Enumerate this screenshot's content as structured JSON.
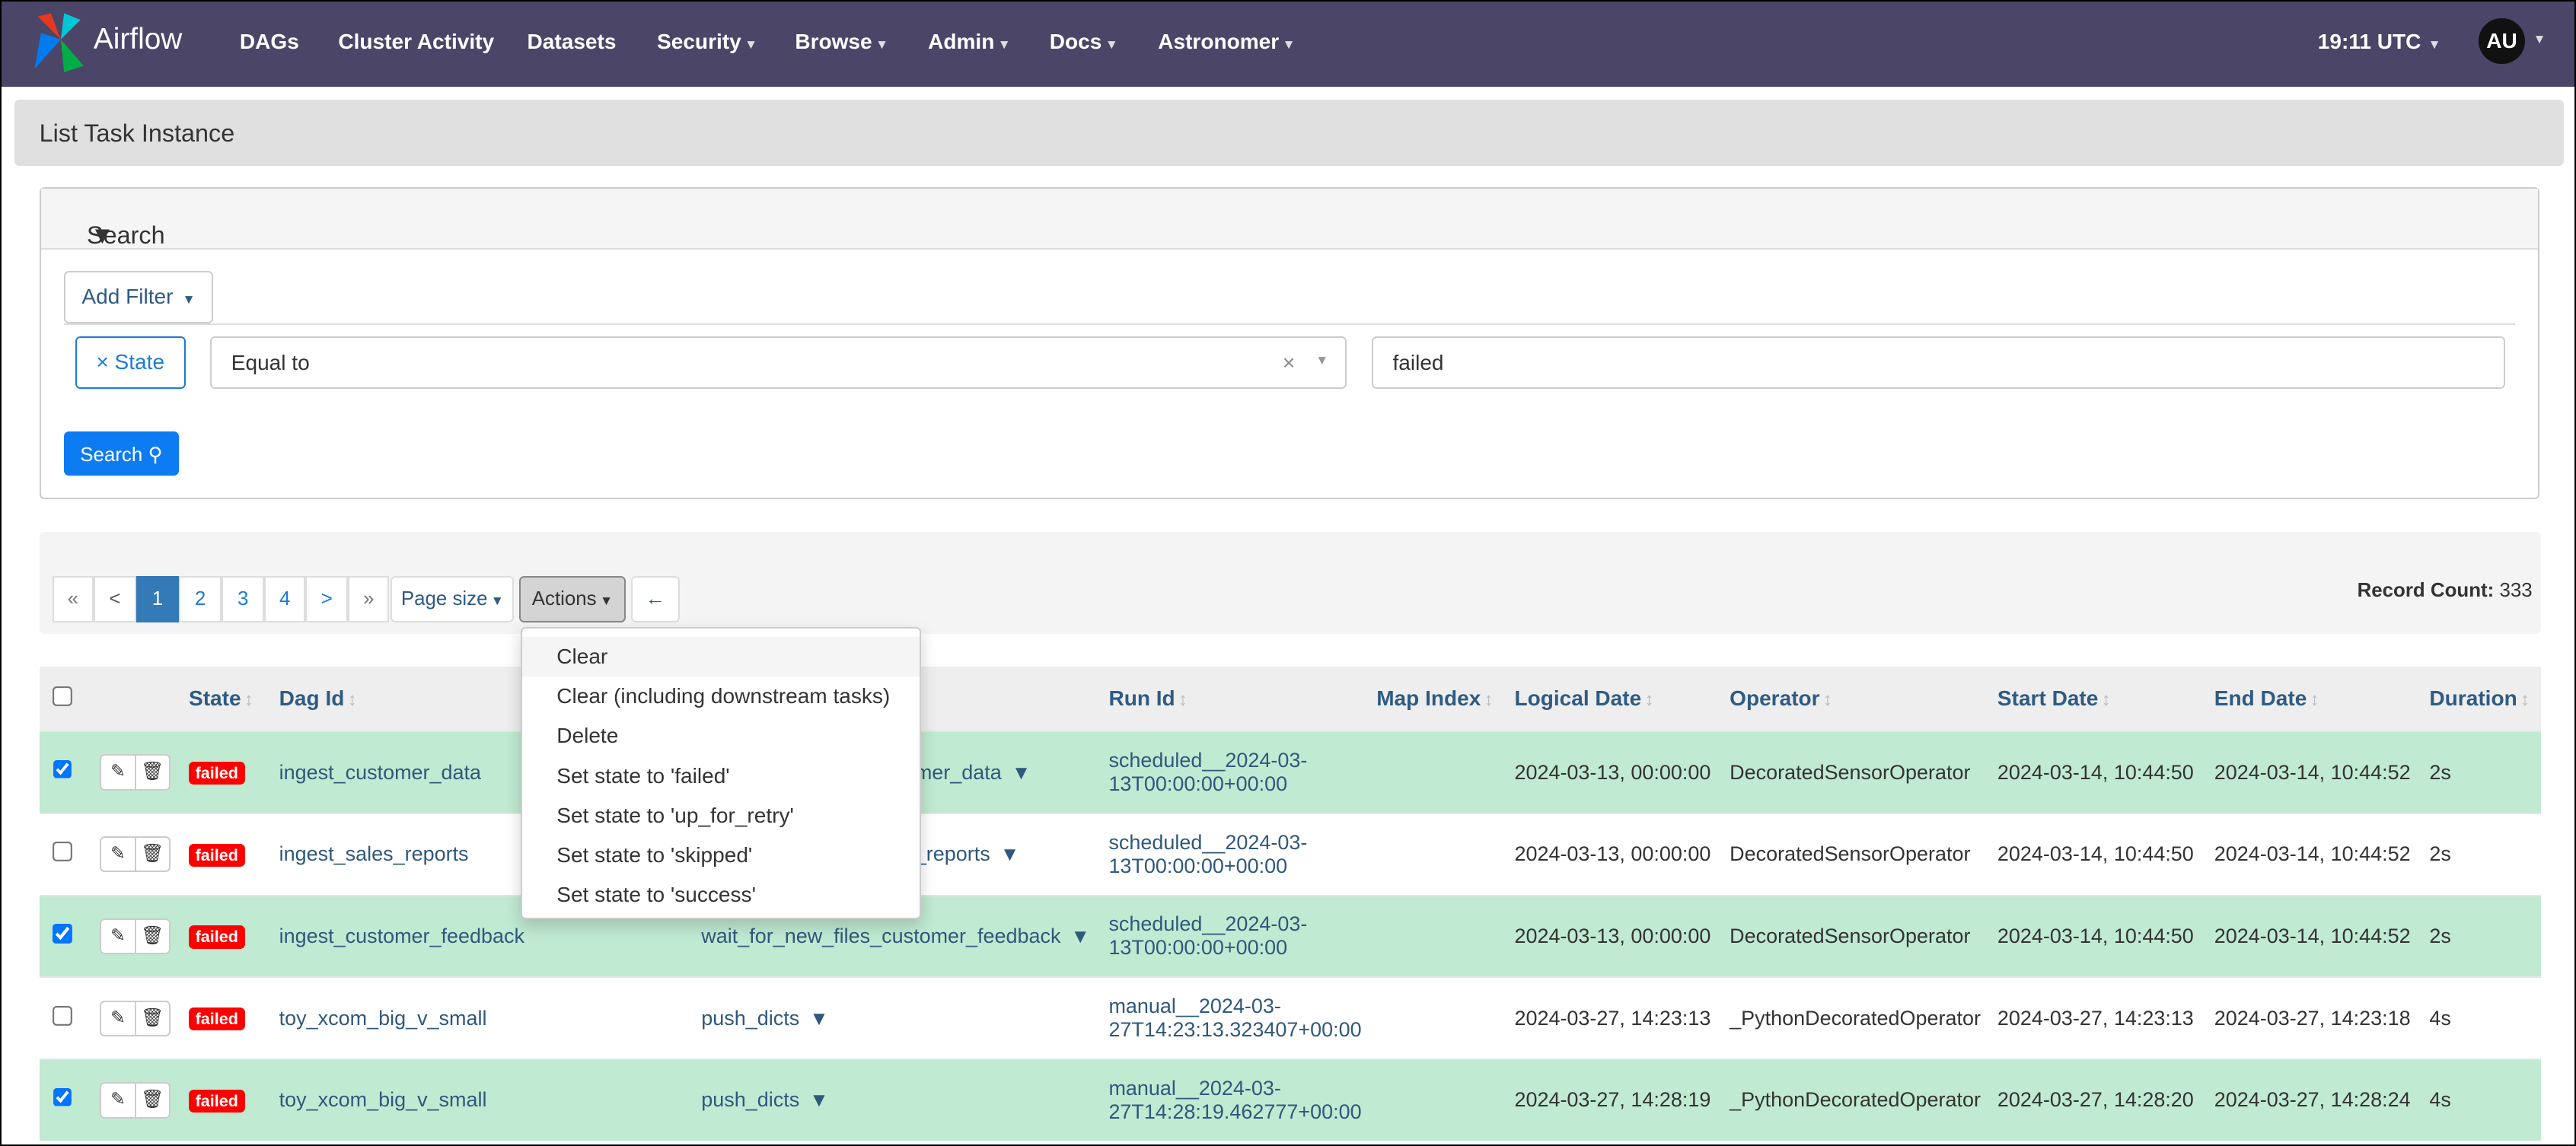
{
  "nav": {
    "brand": "Airflow",
    "items": [
      "DAGs",
      "Cluster Activity",
      "Datasets",
      "Security",
      "Browse",
      "Admin",
      "Docs",
      "Astronomer"
    ],
    "time": "19:11 UTC",
    "user_initials": "AU"
  },
  "page_title": "List Task Instance",
  "search": {
    "title": "Search",
    "add_filter": "Add Filter",
    "filter_field": "× State",
    "operator": "Equal to",
    "clear": "×",
    "value": "failed",
    "search_button": "Search"
  },
  "pagination": {
    "first": "«",
    "prev": "<",
    "pages": [
      "1",
      "2",
      "3",
      "4"
    ],
    "active_page": "1",
    "next": ">",
    "last": "»",
    "page_size": "Page size",
    "actions": "Actions",
    "back": "←"
  },
  "record_count": {
    "label": "Record Count:",
    "value": "333"
  },
  "actions_menu": [
    "Clear",
    "Clear (including downstream tasks)",
    "Delete",
    "Set state to 'failed'",
    "Set state to 'up_for_retry'",
    "Set state to 'skipped'",
    "Set state to 'success'"
  ],
  "table": {
    "headers": {
      "state": "State",
      "dag_id": "Dag Id",
      "run_id": "Run Id",
      "map_index": "Map Index",
      "logical_date": "Logical Date",
      "operator": "Operator",
      "start_date": "Start Date",
      "end_date": "End Date",
      "duration": "Duration"
    },
    "rows": [
      {
        "checked": true,
        "state": "failed",
        "dag_id": "ingest_customer_data",
        "task_id": "mer_data",
        "run_id_1": "scheduled__2024-03-",
        "run_id_2": "13T00:00:00+00:00",
        "logical_date": "2024-03-13, 00:00:00",
        "operator": "DecoratedSensorOperator",
        "start_date": "2024-03-14, 10:44:50",
        "end_date": "2024-03-14, 10:44:52",
        "duration": "2s"
      },
      {
        "checked": false,
        "state": "failed",
        "dag_id": "ingest_sales_reports",
        "task_id": "_reports",
        "run_id_1": "scheduled__2024-03-",
        "run_id_2": "13T00:00:00+00:00",
        "logical_date": "2024-03-13, 00:00:00",
        "operator": "DecoratedSensorOperator",
        "start_date": "2024-03-14, 10:44:50",
        "end_date": "2024-03-14, 10:44:52",
        "duration": "2s"
      },
      {
        "checked": true,
        "state": "failed",
        "dag_id": "ingest_customer_feedback",
        "task_id": "wait_for_new_files_customer_feedback",
        "run_id_1": "scheduled__2024-03-",
        "run_id_2": "13T00:00:00+00:00",
        "logical_date": "2024-03-13, 00:00:00",
        "operator": "DecoratedSensorOperator",
        "start_date": "2024-03-14, 10:44:50",
        "end_date": "2024-03-14, 10:44:52",
        "duration": "2s"
      },
      {
        "checked": false,
        "state": "failed",
        "dag_id": "toy_xcom_big_v_small",
        "task_id": "push_dicts",
        "run_id_1": "manual__2024-03-",
        "run_id_2": "27T14:23:13.323407+00:00",
        "logical_date": "2024-03-27, 14:23:13",
        "operator": "_PythonDecoratedOperator",
        "start_date": "2024-03-27, 14:23:13",
        "end_date": "2024-03-27, 14:23:18",
        "duration": "4s"
      },
      {
        "checked": true,
        "state": "failed",
        "dag_id": "toy_xcom_big_v_small",
        "task_id": "push_dicts",
        "run_id_1": "manual__2024-03-",
        "run_id_2": "27T14:28:19.462777+00:00",
        "logical_date": "2024-03-27, 14:28:19",
        "operator": "_PythonDecoratedOperator",
        "start_date": "2024-03-27, 14:28:20",
        "end_date": "2024-03-27, 14:28:24",
        "duration": "4s"
      }
    ]
  },
  "colors": {
    "navbar": "#4b4568",
    "selected_row": "#c0ead2",
    "failed_badge": "#ff0000",
    "primary": "#0d7bf2"
  }
}
